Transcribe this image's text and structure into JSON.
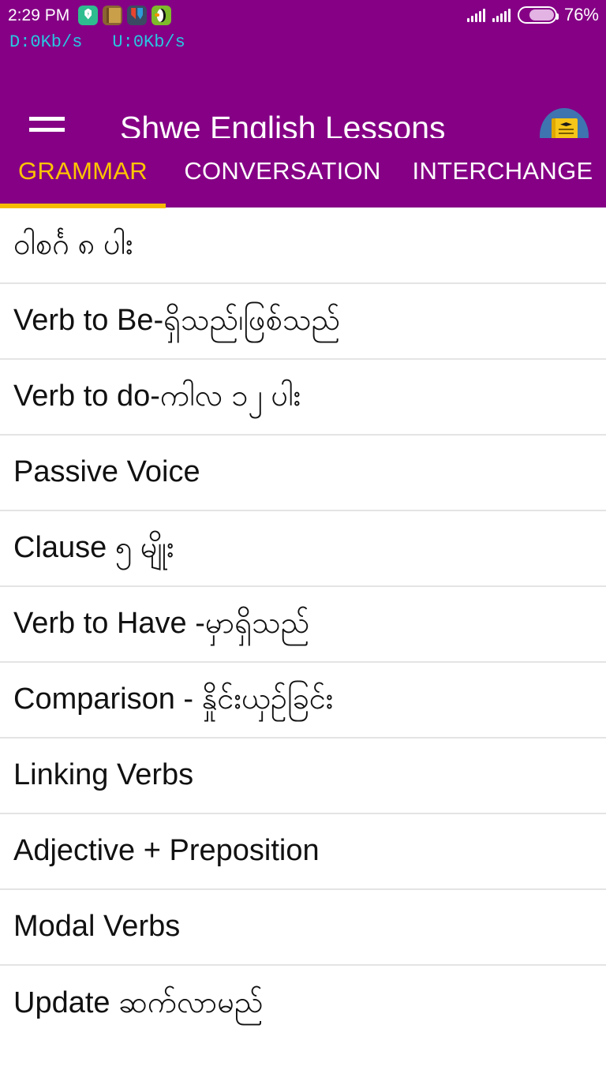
{
  "status_bar": {
    "clock": "2:29 PM",
    "battery_text": "76%",
    "battery_level_percent": 76,
    "icons": [
      {
        "name": "shield-app-icon",
        "label": "shield"
      },
      {
        "name": "book-app-icon",
        "label": "book"
      },
      {
        "name": "download-app-icon",
        "label": "download"
      },
      {
        "name": "puffin-browser-icon",
        "label": "puffin"
      }
    ],
    "signal_indicators": 2
  },
  "network_speed": {
    "download": "D:0Kb/s",
    "upload": "U:0Kb/s",
    "color": "#29c6e0"
  },
  "app_bar": {
    "title": "Shwe English Lessons",
    "menu_icon": "hamburger-menu-icon",
    "logo_icon": "app-logo-book-icon",
    "background_color": "#850085"
  },
  "tabs": {
    "active_index": 0,
    "active_color": "#ffc400",
    "inactive_color": "#ffffff",
    "indicator_color": "#f5ba00",
    "items": [
      {
        "label": "GRAMMAR"
      },
      {
        "label": "CONVERSATION"
      },
      {
        "label": "INTERCHANGE"
      }
    ]
  },
  "lesson_list": {
    "items": [
      {
        "label": "ဝါစင်္ဂ ၈ ပါး"
      },
      {
        "label": "Verb to Be-ရှိသည်၊ဖြစ်သည်"
      },
      {
        "label": "Verb to do-ကါလ ၁၂ ပါး"
      },
      {
        "label": "Passive Voice"
      },
      {
        "label": "Clause  ၅ မျိုး"
      },
      {
        "label": "Verb to Have -မှာရှိသည်"
      },
      {
        "label": "Comparison - နှိုင်းယှဉ်ခြင်း"
      },
      {
        "label": "Linking Verbs"
      },
      {
        "label": "Adjective + Preposition"
      },
      {
        "label": "Modal Verbs"
      },
      {
        "label": "Update ဆက်လာမည်"
      }
    ]
  }
}
